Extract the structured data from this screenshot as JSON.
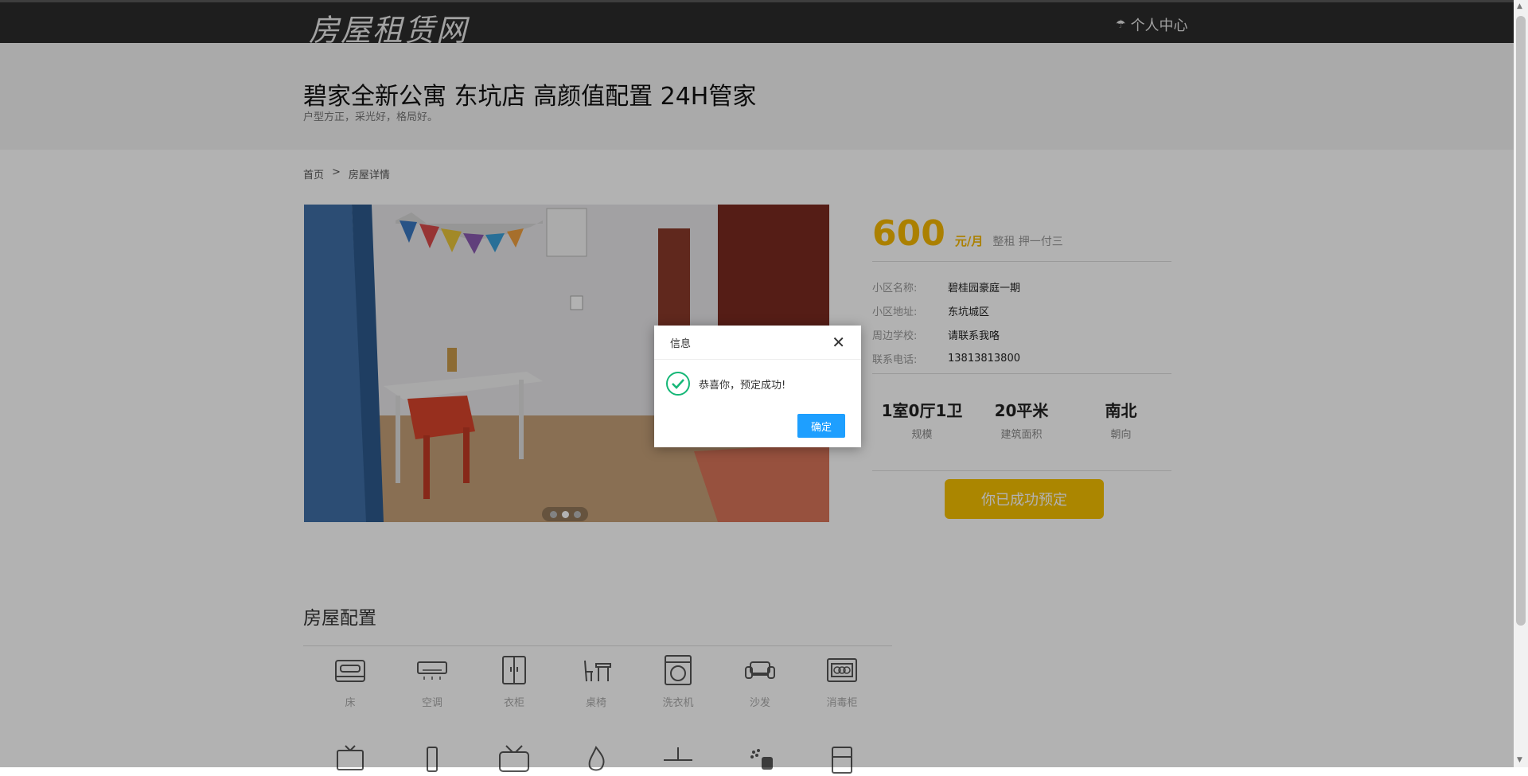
{
  "header": {
    "logo": "房屋租赁网",
    "user_center": "个人中心"
  },
  "house": {
    "title": "碧家全新公寓 东坑店 高颜值配置 24H管家",
    "subtitle": "户型方正，采光好，格局好。"
  },
  "breadcrumb": {
    "home": "首页",
    "separator": ">",
    "current": "房屋详情"
  },
  "carousel": {
    "slide_count": 3,
    "active_index": 1
  },
  "price": {
    "amount": "600",
    "unit": "元/月",
    "rent_type": "整租 押一付三"
  },
  "info": [
    {
      "key": "小区名称:",
      "value": "碧桂园豪庭一期"
    },
    {
      "key": "小区地址:",
      "value": "东坑城区"
    },
    {
      "key": "周边学校:",
      "value": "请联系我咯"
    },
    {
      "key": "联系电话:",
      "value": "13813813800"
    }
  ],
  "stats": [
    {
      "big": "1室0厅1卫",
      "small": "规模"
    },
    {
      "big": "20平米",
      "small": "建筑面积"
    },
    {
      "big": "南北",
      "small": "朝向"
    }
  ],
  "reserve_button": "你已成功预定",
  "amenities": {
    "title": "房屋配置",
    "items": [
      {
        "icon": "bed-icon",
        "label": "床"
      },
      {
        "icon": "air-conditioner-icon",
        "label": "空调"
      },
      {
        "icon": "wardrobe-icon",
        "label": "衣柜"
      },
      {
        "icon": "desk-chair-icon",
        "label": "桌椅"
      },
      {
        "icon": "washing-machine-icon",
        "label": "洗衣机"
      },
      {
        "icon": "sofa-icon",
        "label": "沙发"
      },
      {
        "icon": "sterilizer-icon",
        "label": "消毒柜"
      }
    ],
    "row2_icons": [
      "tv-icon",
      "phone-icon",
      "tv-antenna-icon",
      "gas-flame-icon",
      "desk-icon",
      "shower-icon",
      "fridge-icon"
    ]
  },
  "dialog": {
    "title": "信息",
    "message": "恭喜你，预定成功!",
    "ok_label": "确定"
  },
  "colors": {
    "accent": "#f5b800",
    "dialog_button": "#1e9fff",
    "success": "#16b777"
  }
}
